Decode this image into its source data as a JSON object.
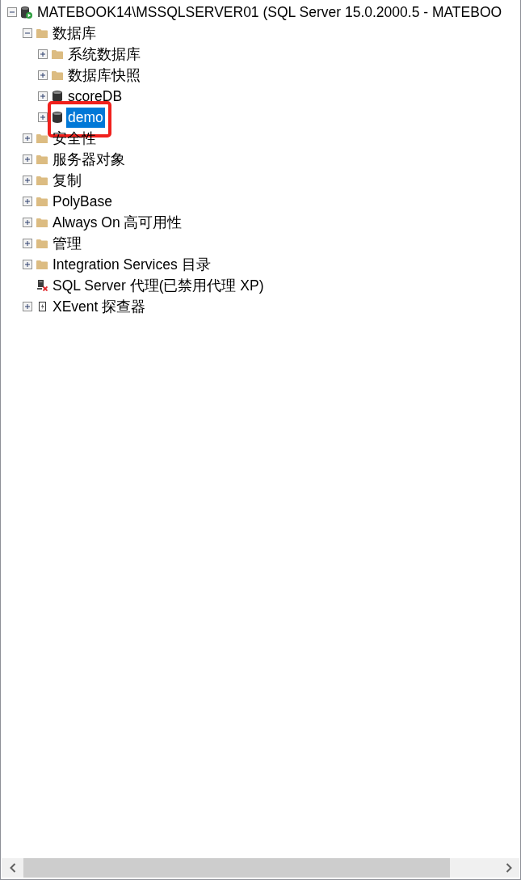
{
  "tree": {
    "items": [
      {
        "kind": "server",
        "label": "MATEBOOK14\\MSSQLSERVER01 (SQL Server 15.0.2000.5 - MATEBOO",
        "expanded": true,
        "selected": false,
        "children": [
          {
            "kind": "folder",
            "label": "数据库",
            "expanded": true,
            "selected": false,
            "children": [
              {
                "kind": "folder",
                "label": "系统数据库",
                "expanded": false,
                "selected": false
              },
              {
                "kind": "folder",
                "label": "数据库快照",
                "expanded": false,
                "selected": false
              },
              {
                "kind": "database",
                "label": "scoreDB",
                "expanded": false,
                "selected": false
              },
              {
                "kind": "database",
                "label": "demo",
                "expanded": false,
                "selected": true,
                "outlined": true
              }
            ]
          },
          {
            "kind": "folder",
            "label": "安全性",
            "expanded": false,
            "selected": false
          },
          {
            "kind": "folder",
            "label": "服务器对象",
            "expanded": false,
            "selected": false
          },
          {
            "kind": "folder",
            "label": "复制",
            "expanded": false,
            "selected": false
          },
          {
            "kind": "folder",
            "label": "PolyBase",
            "expanded": false,
            "selected": false
          },
          {
            "kind": "folder",
            "label": "Always On 高可用性",
            "expanded": false,
            "selected": false
          },
          {
            "kind": "folder",
            "label": "管理",
            "expanded": false,
            "selected": false
          },
          {
            "kind": "folder",
            "label": "Integration Services 目录",
            "expanded": false,
            "selected": false
          },
          {
            "kind": "agent",
            "label": "SQL Server 代理(已禁用代理 XP)",
            "selected": false
          },
          {
            "kind": "xevent",
            "label": "XEvent 探查器",
            "expanded": false,
            "selected": false
          }
        ]
      }
    ]
  }
}
